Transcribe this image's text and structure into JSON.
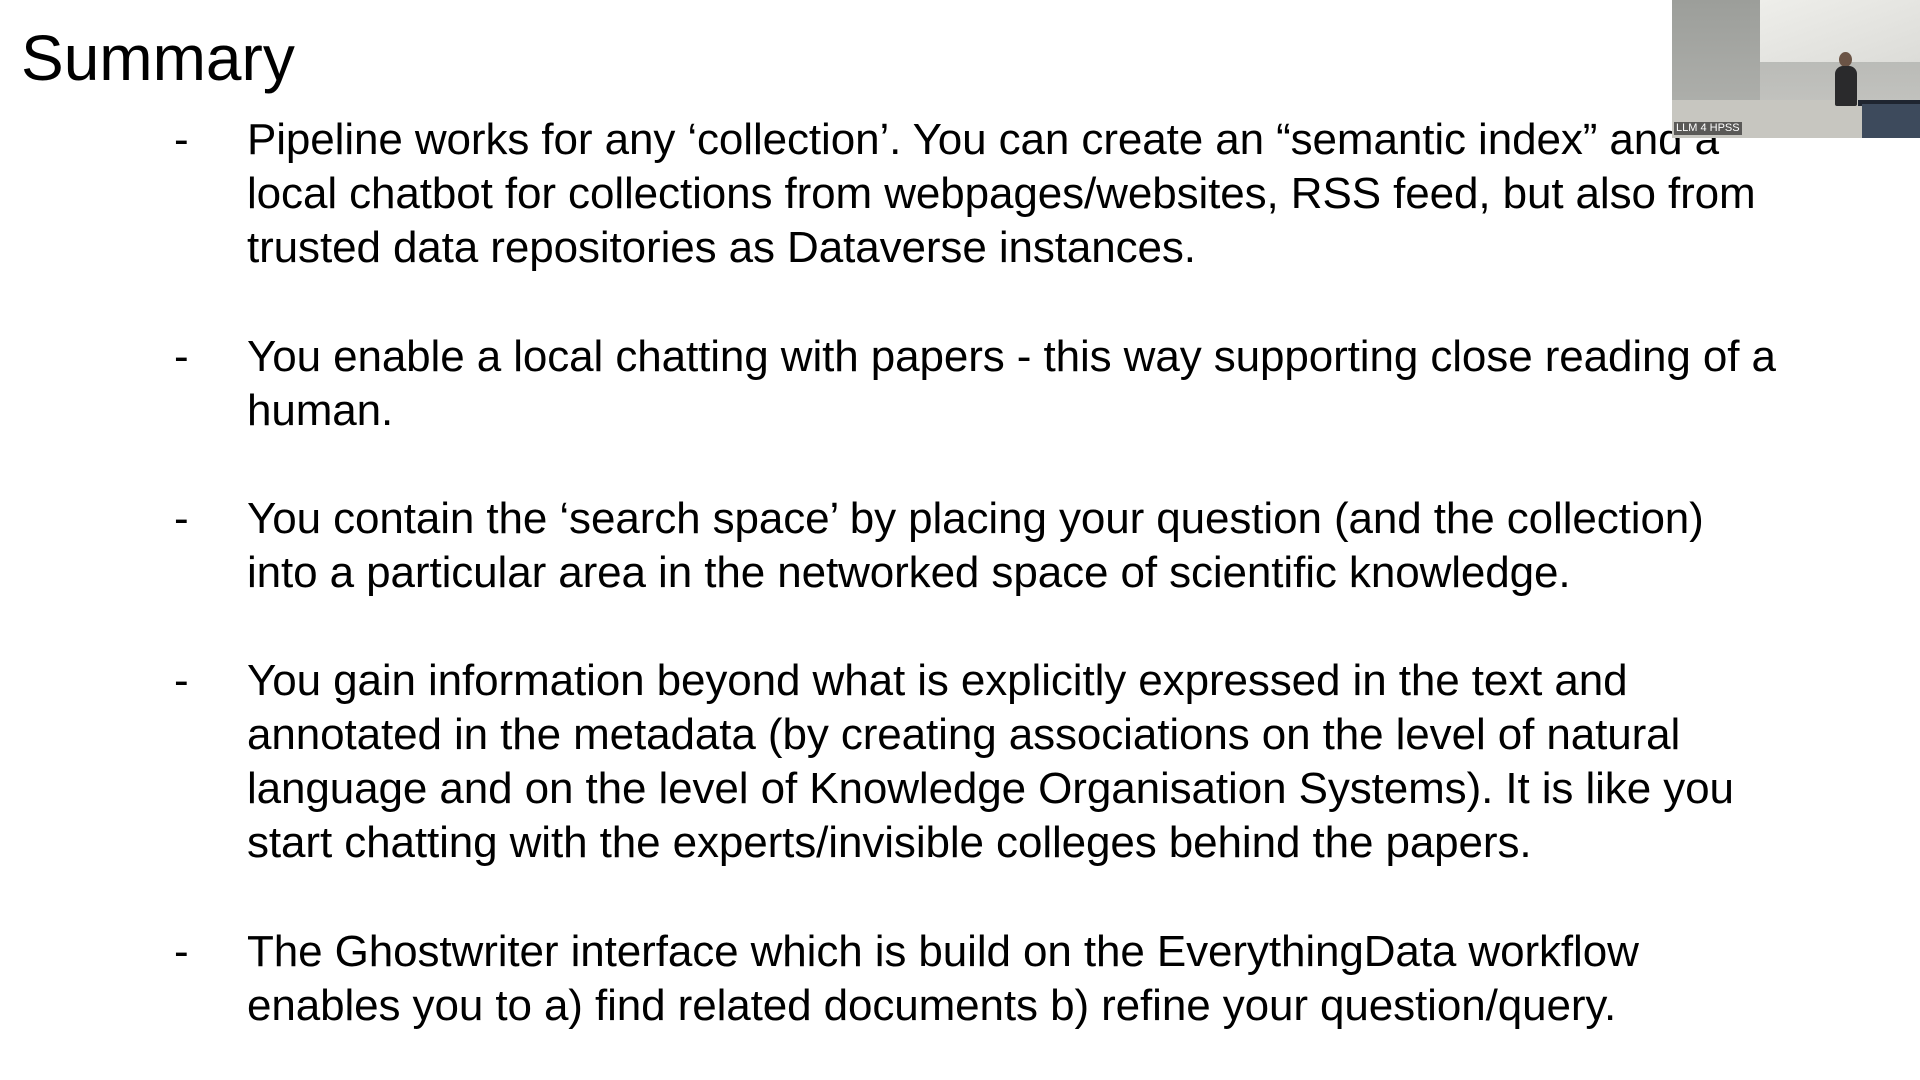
{
  "slide": {
    "title": "Summary",
    "bullets": [
      {
        "marker": "-",
        "lines": [
          "Pipeline works for any ‘collection’. You can create an “semantic index” and a",
          "local chatbot for collections from webpages/websites, RSS feed, but also from",
          "trusted data repositories as Dataverse instances."
        ]
      },
      {
        "marker": "-",
        "lines": [
          "You enable a local chatting with papers - this way supporting close reading of a",
          "human."
        ]
      },
      {
        "marker": "-",
        "lines": [
          "You contain the ‘search space’ by placing your question (and the collection)",
          "into a particular area in the networked space of scientific knowledge."
        ]
      },
      {
        "marker": "-",
        "lines": [
          "You gain information beyond what is explicitly expressed in the text and",
          "annotated in the metadata (by creating associations on the level of natural",
          "language and on the level of Knowledge Organisation Systems). It is like you",
          "start chatting with the experts/invisible colleges behind the papers."
        ]
      },
      {
        "marker": "-",
        "lines": [
          "The Ghostwriter interface which is build on the EverythingData workflow",
          "enables you to a) find related documents b) refine your question/query."
        ]
      }
    ]
  },
  "webcam": {
    "caption": "LLM 4 HPSS"
  }
}
